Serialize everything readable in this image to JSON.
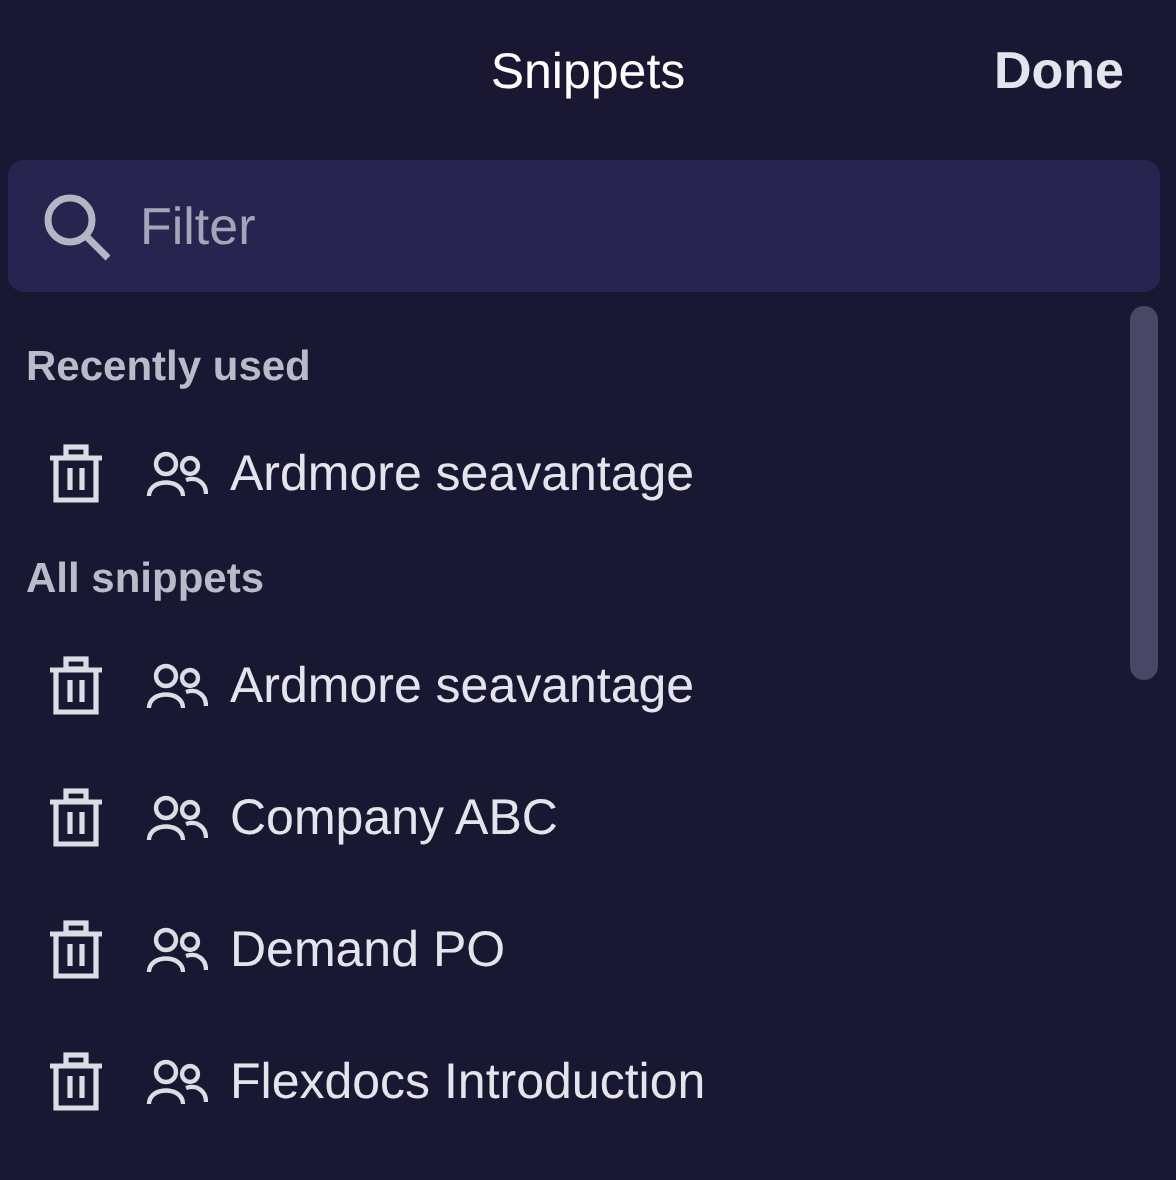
{
  "header": {
    "title": "Snippets",
    "done_button": "Done"
  },
  "search": {
    "placeholder": "Filter"
  },
  "sections": [
    {
      "title": "Recently used",
      "items": [
        {
          "label": "Ardmore seavantage"
        }
      ]
    },
    {
      "title": "All snippets",
      "items": [
        {
          "label": "Ardmore seavantage"
        },
        {
          "label": "Company ABC"
        },
        {
          "label": "Demand PO"
        },
        {
          "label": "Flexdocs Introduction"
        }
      ]
    }
  ]
}
